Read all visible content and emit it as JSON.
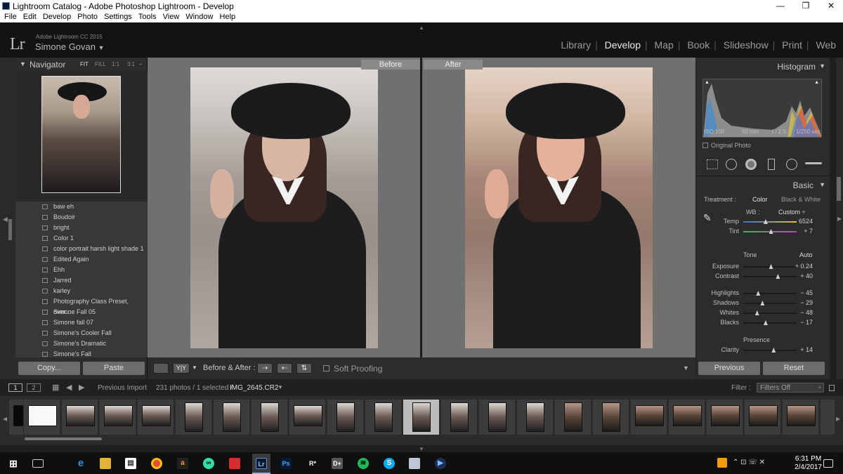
{
  "window": {
    "title": "Lightroom Catalog - Adobe Photoshop Lightroom - Develop",
    "minimize": "—",
    "maximize": "❐",
    "close": "✕"
  },
  "menu": [
    "File",
    "Edit",
    "Develop",
    "Photo",
    "Settings",
    "Tools",
    "View",
    "Window",
    "Help"
  ],
  "identity": {
    "logo": "Lr",
    "version": "Adobe Lightroom CC 2015",
    "user": "Simone Govan"
  },
  "modules": [
    "Library",
    "Develop",
    "Map",
    "Book",
    "Slideshow",
    "Print",
    "Web"
  ],
  "active_module": "Develop",
  "navigator": {
    "title": "Navigator",
    "zoom_options": [
      "FIT",
      "FILL",
      "1:1",
      "3:1"
    ]
  },
  "presets": [
    "baw eh",
    "Boudoir",
    "bright",
    "Color 1",
    "color portrait harsh light shade 1",
    "Edited Again",
    "Ehh",
    "Jarred",
    "karley",
    "Photography Class Preset, over...",
    "Simone Fall 05",
    "Simone fall 07",
    "Simone's Cooler Fall",
    "Simone's Dramatic",
    "Simone's Fall"
  ],
  "left_buttons": {
    "copy": "Copy...",
    "paste": "Paste"
  },
  "compare": {
    "before": "Before",
    "after": "After"
  },
  "toolbar": {
    "view_label": "Y|Y",
    "before_after_label": "Before & After :",
    "soft_proofing": "Soft Proofing"
  },
  "histogram": {
    "title": "Histogram",
    "iso": "ISO 100",
    "focal": "50 mm",
    "aperture": "f / 2.5",
    "shutter": "1/250 sec",
    "original_photo": "Original Photo"
  },
  "basic": {
    "title": "Basic",
    "treatment_label": "Treatment :",
    "treatment_color": "Color",
    "treatment_bw": "Black & White",
    "wb_label": "WB :",
    "wb_value": "Custom ÷",
    "tone_label": "Tone",
    "auto": "Auto",
    "presence": "Presence",
    "sliders": [
      {
        "name": "Temp",
        "value": "6524",
        "pos": 0.42
      },
      {
        "name": "Tint",
        "value": "+ 7",
        "pos": 0.52
      },
      {
        "name": "Exposure",
        "value": "+ 0.24",
        "pos": 0.52
      },
      {
        "name": "Contrast",
        "value": "+ 40",
        "pos": 0.65
      },
      {
        "name": "Highlights",
        "value": "− 45",
        "pos": 0.28
      },
      {
        "name": "Shadows",
        "value": "− 29",
        "pos": 0.36
      },
      {
        "name": "Whites",
        "value": "− 48",
        "pos": 0.26
      },
      {
        "name": "Blacks",
        "value": "− 17",
        "pos": 0.42
      },
      {
        "name": "Clarity",
        "value": "+ 14",
        "pos": 0.57
      }
    ]
  },
  "right_buttons": {
    "previous": "Previous",
    "reset": "Reset"
  },
  "filmstrip_header": {
    "page1": "1",
    "page2": "2",
    "source": "Previous Import",
    "count": "231 photos / 1 selected /",
    "file": "IMG_2645.CR2",
    "filter_label": "Filter :",
    "filter_value": "Filters Off"
  },
  "taskbar": {
    "time": "6:31 PM",
    "date": "2/4/2017",
    "lang_icons": "⌃ ⊡ ☏ ✕"
  }
}
